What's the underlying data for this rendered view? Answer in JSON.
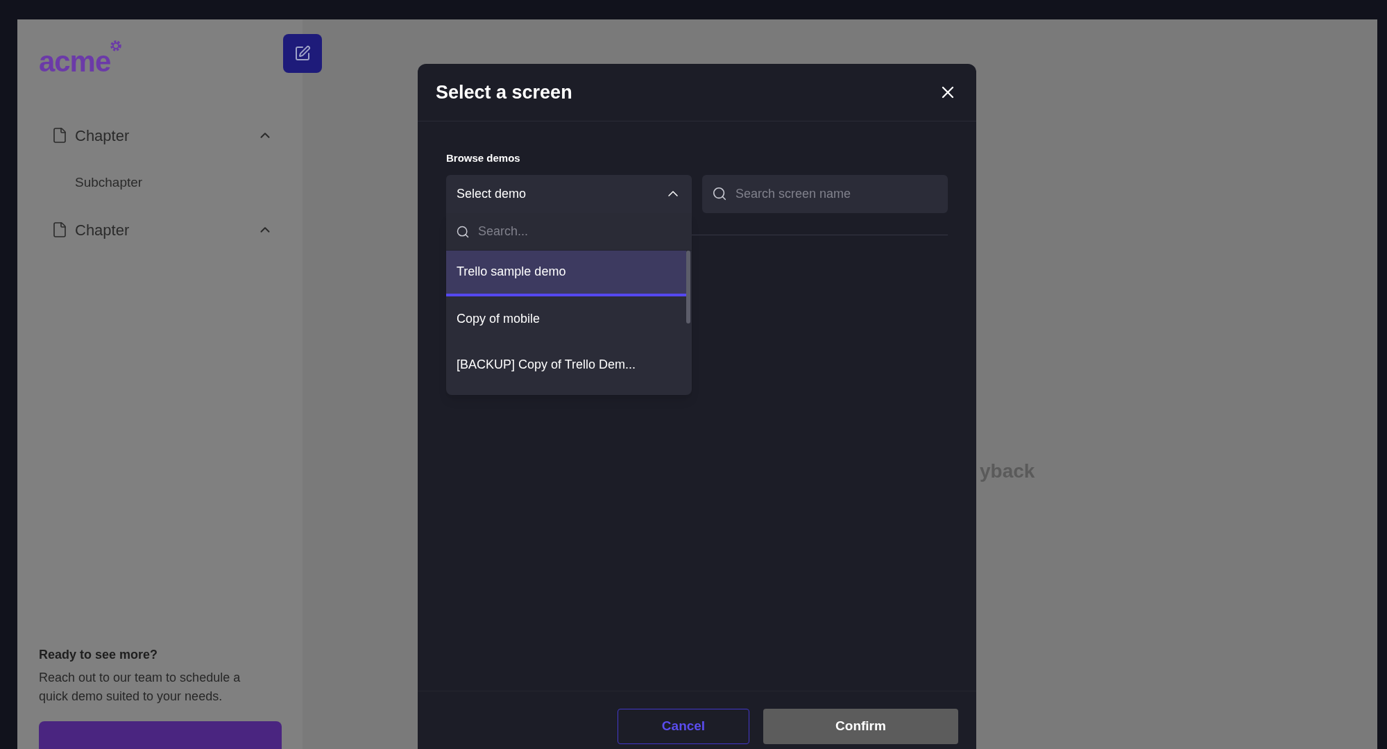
{
  "sidebar": {
    "logo": "acme",
    "chapters": [
      {
        "label": "Chapter",
        "expanded": true,
        "children": [
          {
            "label": "Subchapter"
          }
        ]
      },
      {
        "label": "Chapter",
        "expanded": true
      }
    ],
    "cta": {
      "title": "Ready to see more?",
      "text": "Reach out to our team to schedule a quick demo suited to your needs."
    }
  },
  "main": {
    "text": "yback"
  },
  "modal": {
    "title": "Select a screen",
    "section_label": "Browse demos",
    "demo_select": {
      "value": "Select demo",
      "expanded": true,
      "search_placeholder": "Search...",
      "options": [
        {
          "label": "Trello sample demo",
          "selected": true
        },
        {
          "label": "Copy of mobile",
          "selected": false
        },
        {
          "label": "[BACKUP] Copy of Trello Dem...",
          "selected": false
        }
      ]
    },
    "screen_search": {
      "placeholder": "Search screen name"
    },
    "buttons": [
      {
        "label": "Cancel",
        "kind": "secondary"
      },
      {
        "label": "Confirm",
        "kind": "primary"
      }
    ]
  }
}
